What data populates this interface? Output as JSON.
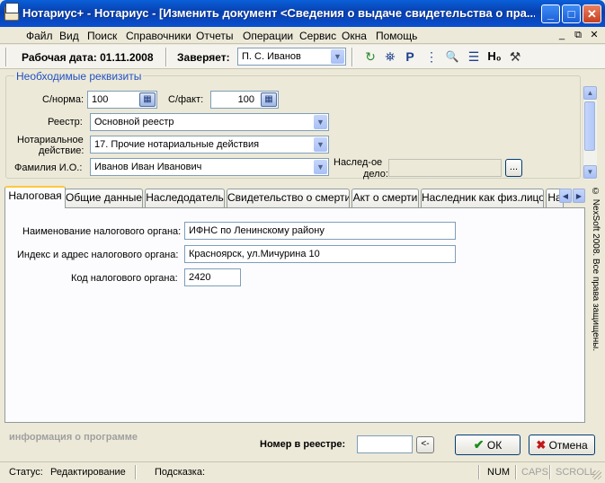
{
  "window": {
    "title": "Нотариус+ - Нотариус - [Изменить документ <Сведения о выдаче свидетельства о пра...",
    "min_glyph": "_",
    "max_glyph": "□",
    "close_glyph": "✕"
  },
  "menu": {
    "items": [
      "Файл",
      "Вид",
      "Поиск",
      "Справочники",
      "Отчеты",
      "Операции",
      "Сервис",
      "Окна",
      "Помощь"
    ],
    "mdi_min": "_",
    "mdi_restore": "⧉",
    "mdi_close": "✕"
  },
  "toolbar": {
    "work_date_label": "Рабочая дата: 01.11.2008",
    "certifies_label": "Заверяет:",
    "certifies_value": "П. С. Иванов",
    "icons": [
      "refresh-icon",
      "binoculars-icon",
      "letter-p-icon",
      "tree-list-icon",
      "search-document-icon",
      "bullet-list-icon",
      "h-zero-icon",
      "tools-icon"
    ],
    "icon_glyphs": [
      "↻",
      "⛯",
      "P",
      "⋮",
      "🔍",
      "☰",
      "H₀",
      "⚒"
    ]
  },
  "group": {
    "caption": "Необходимые реквизиты",
    "norm_label": "С/норма:",
    "norm_value": "100",
    "fact_label": "С/факт:",
    "fact_value": "100",
    "registry_label": "Реестр:",
    "registry_value": "Основной реестр",
    "action_label_1": "Нотариальное",
    "action_label_2": "действие:",
    "action_value": "17. Прочие нотариальные действия",
    "fio_label": "Фамилия И.О.:",
    "fio_value": "Иванов Иван Иванович",
    "inherit_label_1": "Наслед-ое",
    "inherit_label_2": "дело:",
    "inherit_value": "",
    "inherit_button": "..."
  },
  "tabs": [
    "Налоговая",
    "Общие данные",
    "Наследодатель",
    "Свидетельство о смерти",
    "Акт о смерти",
    "Наследник как физ.лицо",
    "На"
  ],
  "tax": {
    "name_label": "Наименование налогового органа:",
    "name_value": "ИФНС по Ленинскому району",
    "address_label": "Индекс и адрес налогового органа:",
    "address_value": "Красноярск, ул.Мичурина 10",
    "code_label": "Код налогового органа:",
    "code_value": "2420"
  },
  "copyright": "© NexSoft 2008. Все права защищены.",
  "bottom": {
    "about": "информация о программе",
    "registry_number_label": "Номер в реестре:",
    "registry_number_value": "",
    "back_button": "<-",
    "ok_label": "ОК",
    "cancel_label": "Отмена",
    "ok_glyph": "✔",
    "cancel_glyph": "✖"
  },
  "status": {
    "status_label": "Статус:",
    "status_value": "Редактирование",
    "hint_label": "Подсказка:",
    "hint_value": "",
    "num": "NUM",
    "caps": "CAPS",
    "scroll": "SCROLL"
  },
  "colors": {
    "accent": "#2250c2",
    "ok_check": "#1a8c1a",
    "cancel_x": "#c01818"
  }
}
